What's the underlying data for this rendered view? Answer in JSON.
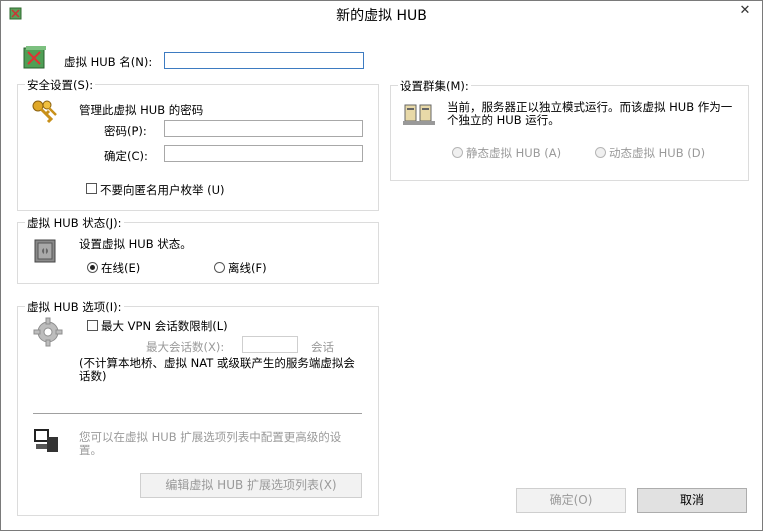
{
  "window": {
    "title": "新的虚拟 HUB",
    "close_glyph": "✕"
  },
  "hub_name": {
    "label": "虚拟 HUB 名(N):",
    "value": ""
  },
  "security": {
    "group_label": "安全设置(S):",
    "heading": "管理此虚拟 HUB 的密码",
    "password_label": "密码(P):",
    "password_value": "",
    "confirm_label": "确定(C):",
    "confirm_value": "",
    "anon_enum_label": "不要向匿名用户枚举 (U)",
    "anon_enum_checked": false
  },
  "status": {
    "group_label": "虚拟 HUB 状态(J):",
    "heading": "设置虚拟 HUB 状态。",
    "online_label": "在线(E)",
    "offline_label": "离线(F)",
    "selected": "online"
  },
  "options": {
    "group_label": "虚拟 HUB 选项(I):",
    "max_sessions_label": "最大 VPN 会话数限制(L)",
    "max_sessions_checked": false,
    "max_sessions_field_label": "最大会话数(X):",
    "max_sessions_value": "",
    "sessions_unit": "会话",
    "note": "(不计算本地桥、虚拟 NAT 或级联产生的服务端虚拟会话数)",
    "ext_note": "您可以在虚拟 HUB 扩展选项列表中配置更高级的设置。",
    "ext_button": "编辑虚拟 HUB 扩展选项列表(X)"
  },
  "cluster": {
    "group_label": "设置群集(M):",
    "description": "当前，服务器正以独立模式运行。而该虚拟 HUB 作为一个独立的 HUB 运行。",
    "static_label": "静态虚拟 HUB (A)",
    "dynamic_label": "动态虚拟 HUB (D)"
  },
  "footer": {
    "ok_label": "确定(O)",
    "cancel_label": "取消"
  },
  "icons": {
    "app": "hub-app-icon",
    "hub": "hub-server-icon",
    "keys": "keys-icon",
    "safe": "safe-icon",
    "gear": "gear-icon",
    "cluster": "cluster-servers-icon",
    "pc": "computer-icon",
    "close": "close-icon"
  },
  "colors": {
    "focus_border": "#3d7bc1",
    "disabled_text": "#9a9a9a",
    "group_border": "#dcdcdc"
  }
}
